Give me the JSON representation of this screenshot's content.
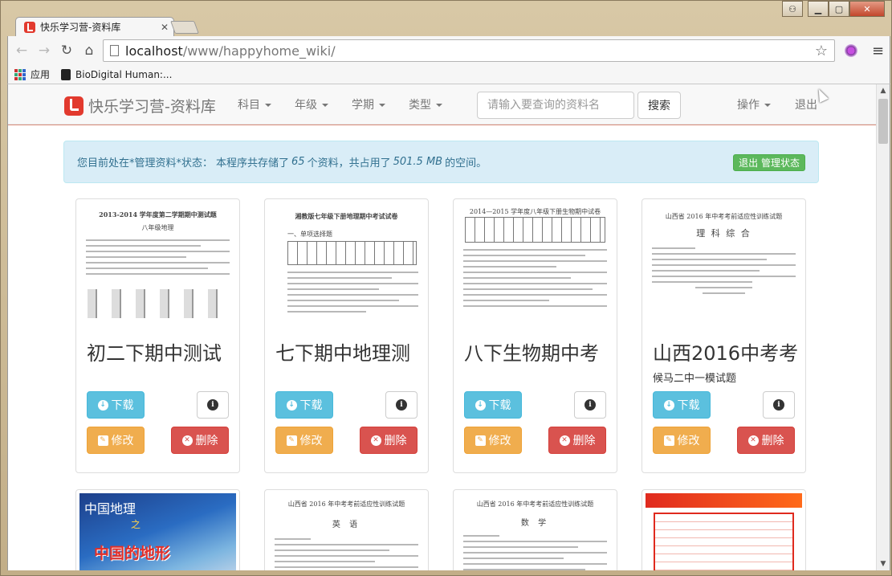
{
  "window": {
    "tab_title": "快乐学习营-资料库",
    "tab_close": "✕"
  },
  "toolbar": {
    "url_host": "localhost",
    "url_path": "/www/happyhome_wiki/"
  },
  "bookmarks": [
    {
      "label": "应用"
    },
    {
      "label": "BioDigital Human:..."
    }
  ],
  "navbar": {
    "brand": "快乐学习营-资料库",
    "menus": [
      "科目",
      "年级",
      "学期",
      "类型"
    ],
    "search_placeholder": "请输入要查询的资料名",
    "search_button": "搜索",
    "actions_label": "操作",
    "logout_label": "退出"
  },
  "alert": {
    "prefix": "您目前处在*管理资料*状态：",
    "text1": "本程序共存储了",
    "count": "65",
    "text2": "个资料，共占用了",
    "size": "501.5 MB",
    "text3": "的空间。",
    "exit_button": "退出 管理状态"
  },
  "card_buttons": {
    "download": "下载",
    "edit": "修改",
    "delete": "删除"
  },
  "cards": [
    {
      "title": "初二下期中测试",
      "subtitle": "",
      "thumb_heading": "2013-2014 学年度第二学期期中测试题",
      "thumb_sub": "八年级地理"
    },
    {
      "title": "七下期中地理测",
      "subtitle": "",
      "thumb_heading": "湘教版七年级下册地理期中考试试卷",
      "thumb_sub": "一、单项选择题"
    },
    {
      "title": "八下生物期中考",
      "subtitle": "",
      "thumb_heading": "2014—2015 学年度八年级下册生物期中试卷",
      "thumb_sub": ""
    },
    {
      "title": "山西2016中考考",
      "subtitle": "候马二中一模试题",
      "thumb_heading": "山西省 2016 年中考考前适应性训练试题",
      "thumb_sub": "理 科 综 合"
    }
  ],
  "lower_cards": [
    {
      "type": "map",
      "t1": "中国地理",
      "t2": "之",
      "t3": "中国的地形"
    },
    {
      "type": "doc",
      "heading": "山西省 2016 年中考考前适应性训练试题",
      "sub": "英 语"
    },
    {
      "type": "doc",
      "heading": "山西省 2016 年中考考前适应性训练试题",
      "sub": "数 学"
    },
    {
      "type": "red"
    }
  ],
  "colors": {
    "brand_red": "#e23a2e",
    "info": "#5bc0de",
    "warning": "#f0ad4e",
    "danger": "#d9534f",
    "success": "#5cb85c"
  }
}
